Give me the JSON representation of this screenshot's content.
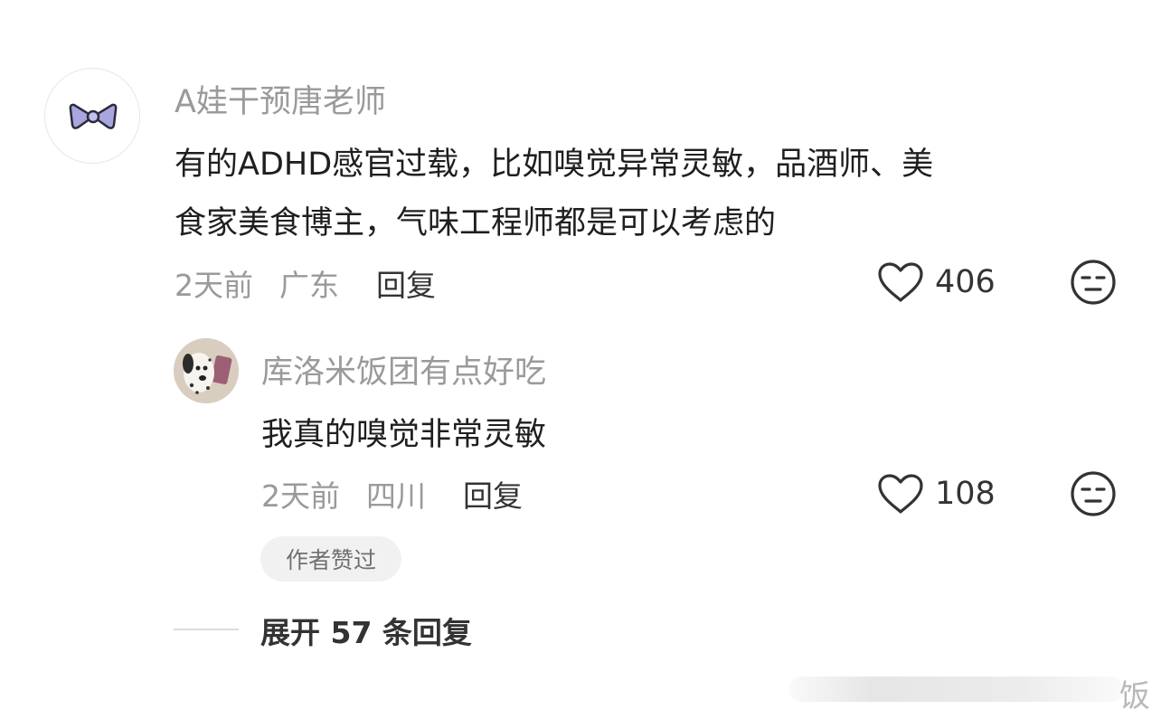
{
  "comment": {
    "username": "A娃干预唐老师",
    "text_line1": "有的ADHD感官过载，比如嗅觉异常灵敏，品酒师、美",
    "text_line2": "食家美食博主，气味工程师都是可以考虑的",
    "time": "2天前",
    "location": "广东",
    "reply_label": "回复",
    "likes": "406",
    "avatar_icon": "bow-icon",
    "avatar_color": "#9b97d6"
  },
  "reply": {
    "username": "库洛米饭团有点好吃",
    "text": "我真的嗅觉非常灵敏",
    "time": "2天前",
    "location": "四川",
    "reply_label": "回复",
    "likes": "108",
    "badge": "作者赞过",
    "avatar_icon": "dalmatian-icon"
  },
  "expand_label": "展开 57 条回复",
  "watermark_text": "饭",
  "icons": {
    "like": "heart-outline-icon",
    "dislike": "neutral-face-icon"
  }
}
